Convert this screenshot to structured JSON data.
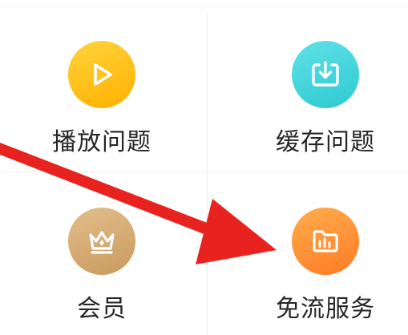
{
  "tiles": [
    {
      "label": "播放问题",
      "icon": "play-icon",
      "color": "#ffc21c"
    },
    {
      "label": "缓存问题",
      "icon": "download-icon",
      "color": "#3fd2da"
    },
    {
      "label": "会员",
      "icon": "crown-icon",
      "color": "#d7ae72"
    },
    {
      "label": "免流服务",
      "icon": "data-folder-icon",
      "color": "#ff9234"
    }
  ],
  "annotation": {
    "arrow_color": "#e8231f"
  }
}
